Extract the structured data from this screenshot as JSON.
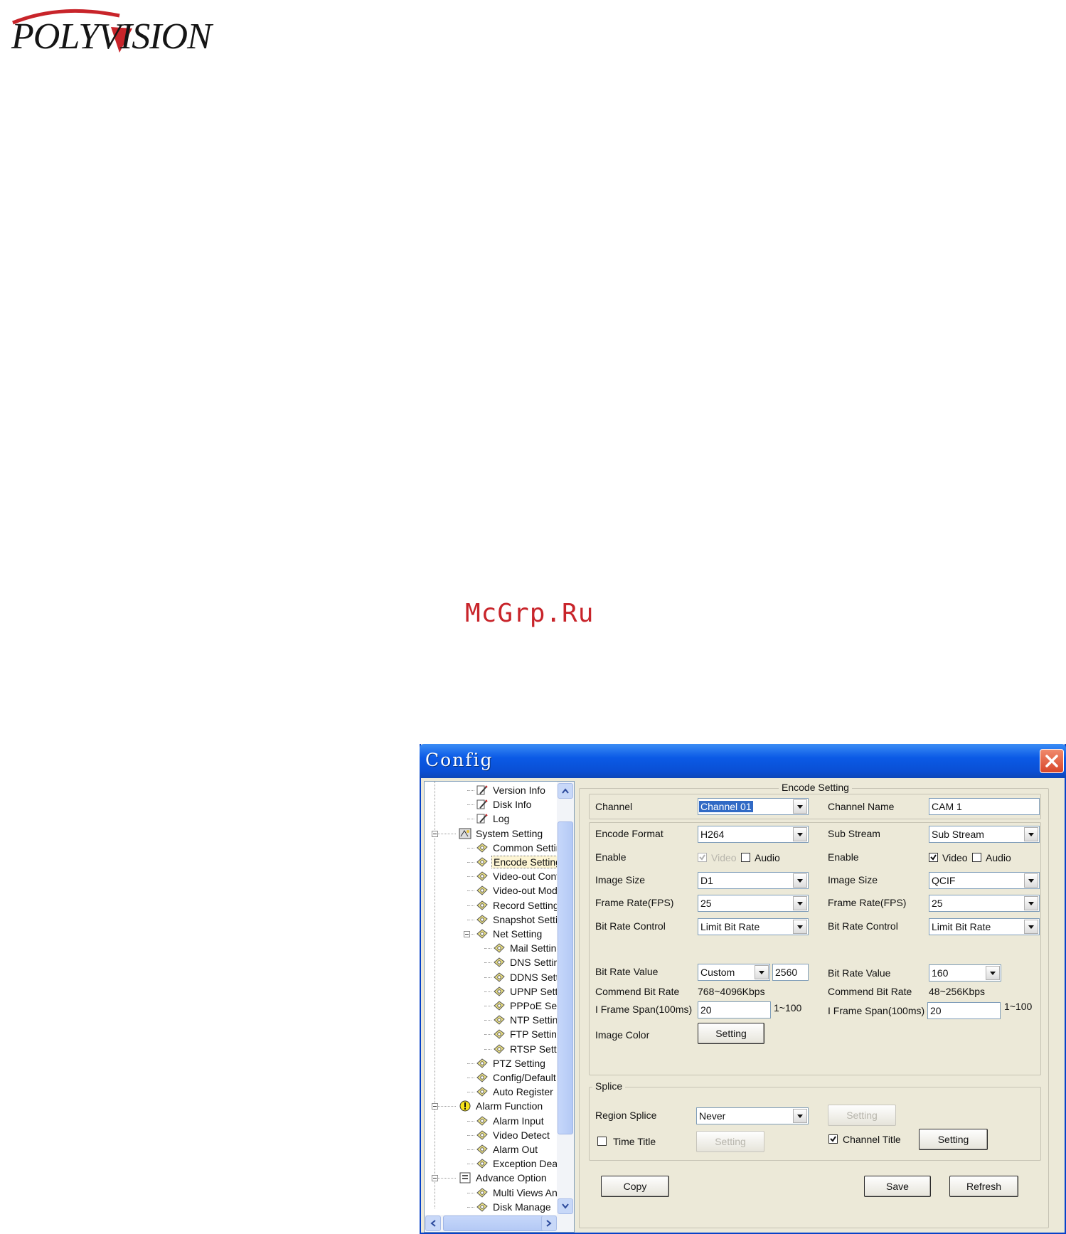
{
  "brand": {
    "logo_text": "POLYVISION",
    "watermark": "McGrp.Ru"
  },
  "window": {
    "title": "Config"
  },
  "tree": {
    "items": [
      {
        "label": "Version Info"
      },
      {
        "label": "Disk Info"
      },
      {
        "label": "Log"
      },
      {
        "label": "System Setting"
      },
      {
        "label": "Common Setting"
      },
      {
        "label": "Encode Setting",
        "selected": true
      },
      {
        "label": "Video-out Config"
      },
      {
        "label": "Video-out Mode"
      },
      {
        "label": "Record Setting"
      },
      {
        "label": "Snapshot Setting"
      },
      {
        "label": "Net Setting"
      },
      {
        "label": "Mail Setting"
      },
      {
        "label": "DNS Setting"
      },
      {
        "label": "DDNS Setting"
      },
      {
        "label": "UPNP Setting"
      },
      {
        "label": "PPPoE Setting"
      },
      {
        "label": "NTP Setting"
      },
      {
        "label": "FTP Setting"
      },
      {
        "label": "RTSP Setting"
      },
      {
        "label": "PTZ Setting"
      },
      {
        "label": "Config/Default"
      },
      {
        "label": "Auto Register"
      },
      {
        "label": "Alarm Function"
      },
      {
        "label": "Alarm Input"
      },
      {
        "label": "Video Detect"
      },
      {
        "label": "Alarm Out"
      },
      {
        "label": "Exception Deal"
      },
      {
        "label": "Advance Option"
      },
      {
        "label": "Multi Views And Tou"
      },
      {
        "label": "Disk Manage"
      }
    ]
  },
  "encode": {
    "group_title": "Encode Setting",
    "channel_label": "Channel",
    "channel_value": "Channel 01",
    "channel_name_label": "Channel Name",
    "channel_name_value": "CAM 1",
    "main": {
      "encode_format_label": "Encode Format",
      "encode_format_value": "H264",
      "enable_label": "Enable",
      "video_label": "Video",
      "audio_label": "Audio",
      "image_size_label": "Image Size",
      "image_size_value": "D1",
      "frame_rate_label": "Frame Rate(FPS)",
      "frame_rate_value": "25",
      "bit_rate_control_label": "Bit Rate Control",
      "bit_rate_control_value": "Limit Bit Rate",
      "bit_rate_value_label": "Bit Rate Value",
      "bit_rate_value_select": "Custom",
      "bit_rate_value_input": "2560",
      "commend_label": "Commend Bit Rate",
      "commend_value": "768~4096Kbps",
      "iframe_label": "I Frame Span(100ms)",
      "iframe_value": "20",
      "iframe_range": "1~100",
      "image_color_label": "Image Color",
      "image_color_button": "Setting"
    },
    "sub": {
      "sub_stream_label": "Sub Stream",
      "sub_stream_value": "Sub Stream",
      "enable_label": "Enable",
      "video_label": "Video",
      "audio_label": "Audio",
      "image_size_label": "Image Size",
      "image_size_value": "QCIF",
      "frame_rate_label": "Frame Rate(FPS)",
      "frame_rate_value": "25",
      "bit_rate_control_label": "Bit Rate Control",
      "bit_rate_control_value": "Limit Bit Rate",
      "bit_rate_value_label": "Bit Rate Value",
      "bit_rate_value_select": "160",
      "commend_label": "Commend Bit Rate",
      "commend_value": "48~256Kbps",
      "iframe_label": "I Frame Span(100ms)",
      "iframe_value": "20",
      "iframe_range": "1~100"
    },
    "splice": {
      "title": "Splice",
      "region_label": "Region Splice",
      "region_value": "Never",
      "region_setting": "Setting",
      "time_title_label": "Time Title",
      "time_title_setting": "Setting",
      "channel_title_label": "Channel Title",
      "channel_title_setting": "Setting"
    },
    "buttons": {
      "copy": "Copy",
      "save": "Save",
      "refresh": "Refresh"
    }
  }
}
